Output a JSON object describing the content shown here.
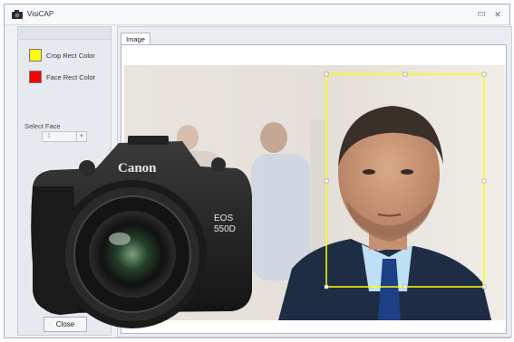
{
  "window": {
    "title": "VisiCAP",
    "minimize_glyph": "▭",
    "close_glyph": "✕"
  },
  "left_panel": {
    "crop_rect": {
      "label": "Crop Rect Color",
      "color": "#ffff00"
    },
    "face_rect": {
      "label": "Face Rect Color",
      "color": "#ff0000"
    },
    "select_face_label": "Select Face",
    "select_face_value": "1",
    "close_button_label": "Close"
  },
  "tabs": [
    {
      "label": "Image"
    }
  ],
  "image": {
    "crop_rect_color": "#ffff00"
  },
  "camera_overlay": {
    "brand": "Canon",
    "model_line1": "EOS",
    "model_line2": "550D"
  },
  "icons": [
    "app-icon",
    "minimize-icon",
    "close-icon",
    "dropdown-arrow-icon",
    "camera-image"
  ]
}
